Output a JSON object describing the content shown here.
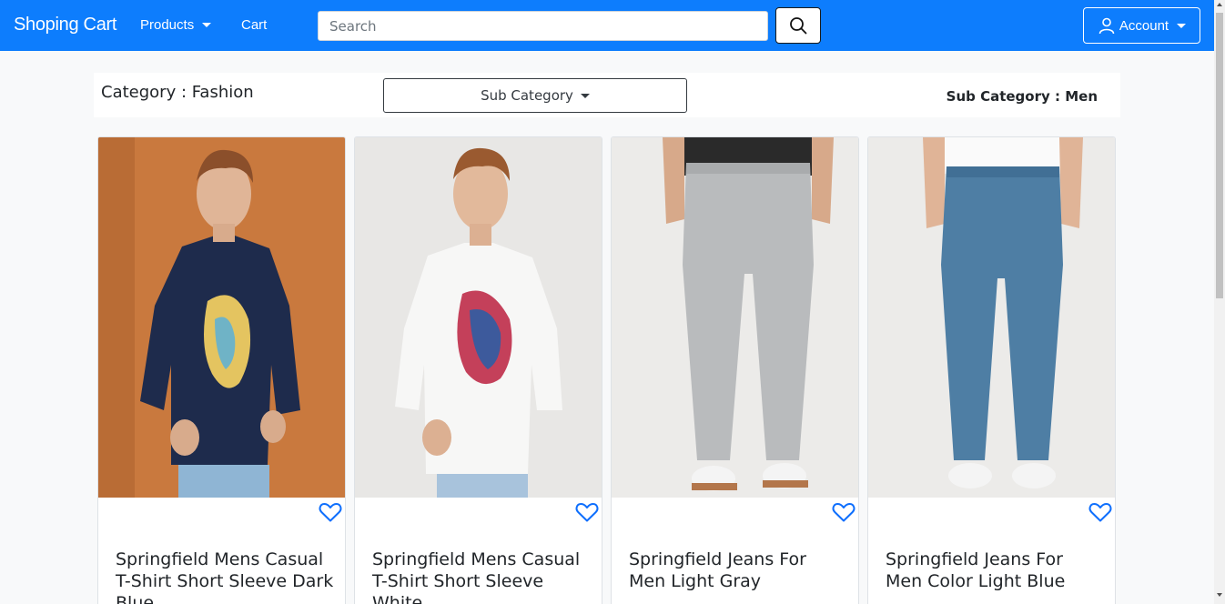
{
  "navbar": {
    "brand": "Shoping Cart",
    "products_label": "Products",
    "cart_label": "Cart",
    "search_placeholder": "Search",
    "account_label": "Account"
  },
  "filter": {
    "category_title": "Category : Fashion",
    "subcategory_button": "Sub Category",
    "subcategory_selected": "Sub Category : Men"
  },
  "products": [
    {
      "title": "Springfield Mens Casual T-Shirt Short Sleeve Dark Blue",
      "image": "man-dark-blue-tshirt"
    },
    {
      "title": "Springfield Mens Casual T-Shirt Short Sleeve White",
      "image": "man-white-tshirt"
    },
    {
      "title": "Springfield Jeans For Men Light Gray",
      "image": "light-gray-jeans"
    },
    {
      "title": "Springfield Jeans For Men Color Light Blue",
      "image": "light-blue-jeans"
    }
  ],
  "colors": {
    "navbar": "#0d7dfd",
    "heart": "#0d6efd"
  }
}
